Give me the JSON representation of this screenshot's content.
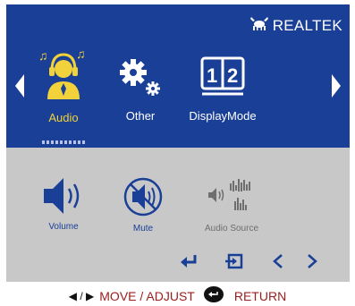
{
  "brand": {
    "name": "REALTEK"
  },
  "menu": {
    "items": [
      {
        "label": "Audio",
        "icon": "headphones-person-icon",
        "active": true
      },
      {
        "label": "Other",
        "icon": "gears-icon",
        "active": false
      },
      {
        "label": "DisplayMode",
        "icon": "display-mode-icon",
        "active": false
      }
    ]
  },
  "submenu": {
    "items": [
      {
        "label": "Volume",
        "icon": "speaker-icon",
        "enabled": true
      },
      {
        "label": "Mute",
        "icon": "mute-icon",
        "enabled": true
      },
      {
        "label": "Audio Source",
        "icon": "audio-source-icon",
        "enabled": false
      }
    ]
  },
  "footer": {
    "arrows": "◀ / ▶",
    "move_adjust": "MOVE / ADJUST",
    "return": "RETURN"
  },
  "colors": {
    "top_bar": "#1a3f96",
    "bottom_panel": "#c8c8c8",
    "active_label": "#f1d23a",
    "footer_text": "#9a1c1c"
  }
}
